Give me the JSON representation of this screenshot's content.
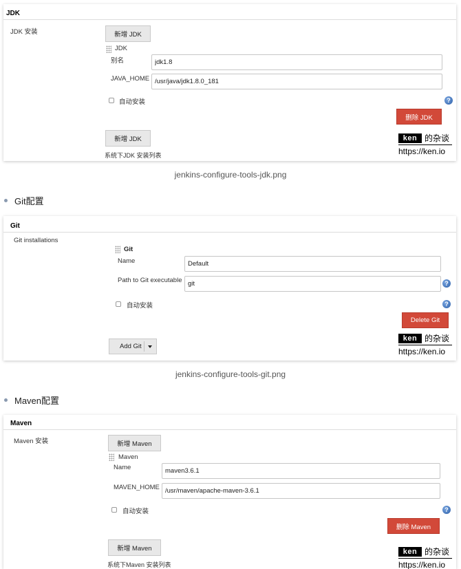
{
  "jdk": {
    "title": "JDK",
    "install_label": "JDK 安装",
    "add_button": "新增 JDK",
    "sub_title": "JDK",
    "alias_label": "别名",
    "alias_value": "jdk1.8",
    "home_label": "JAVA_HOME",
    "home_value": "/usr/java/jdk1.8.0_181",
    "auto_install": "自动安装",
    "delete_button": "删除 JDK",
    "add_button_bottom": "新增 JDK",
    "list_desc": "系统下JDK 安装列表"
  },
  "caption_jdk": "jenkins-configure-tools-jdk.png",
  "bullet_git": "Git配置",
  "git": {
    "title": "Git",
    "install_label": "Git installations",
    "sub_title": "Git",
    "name_label": "Name",
    "name_value": "Default",
    "path_label": "Path to Git executable",
    "path_value": "git",
    "auto_install": "自动安装",
    "delete_button": "Delete Git",
    "add_button": "Add Git"
  },
  "caption_git": "jenkins-configure-tools-git.png",
  "bullet_maven": "Maven配置",
  "maven": {
    "title": "Maven",
    "install_label": "Maven 安装",
    "add_button": "新增 Maven",
    "sub_title": "Maven",
    "name_label": "Name",
    "name_value": "maven3.6.1",
    "home_label": "MAVEN_HOME",
    "home_value": "/usr/maven/apache-maven-3.6.1",
    "auto_install": "自动安装",
    "delete_button": "删除 Maven",
    "add_button_bottom": "新增 Maven",
    "list_desc": "系统下Maven 安装列表"
  },
  "watermark": {
    "brand": "ken",
    "suffix": "的杂谈",
    "url": "https://ken.io"
  },
  "icons": {
    "help": "help-icon",
    "grip": "drag-handle-icon",
    "caret": "caret-down-icon"
  },
  "colors": {
    "danger": "#d24939",
    "help": "#2c5fa8"
  }
}
